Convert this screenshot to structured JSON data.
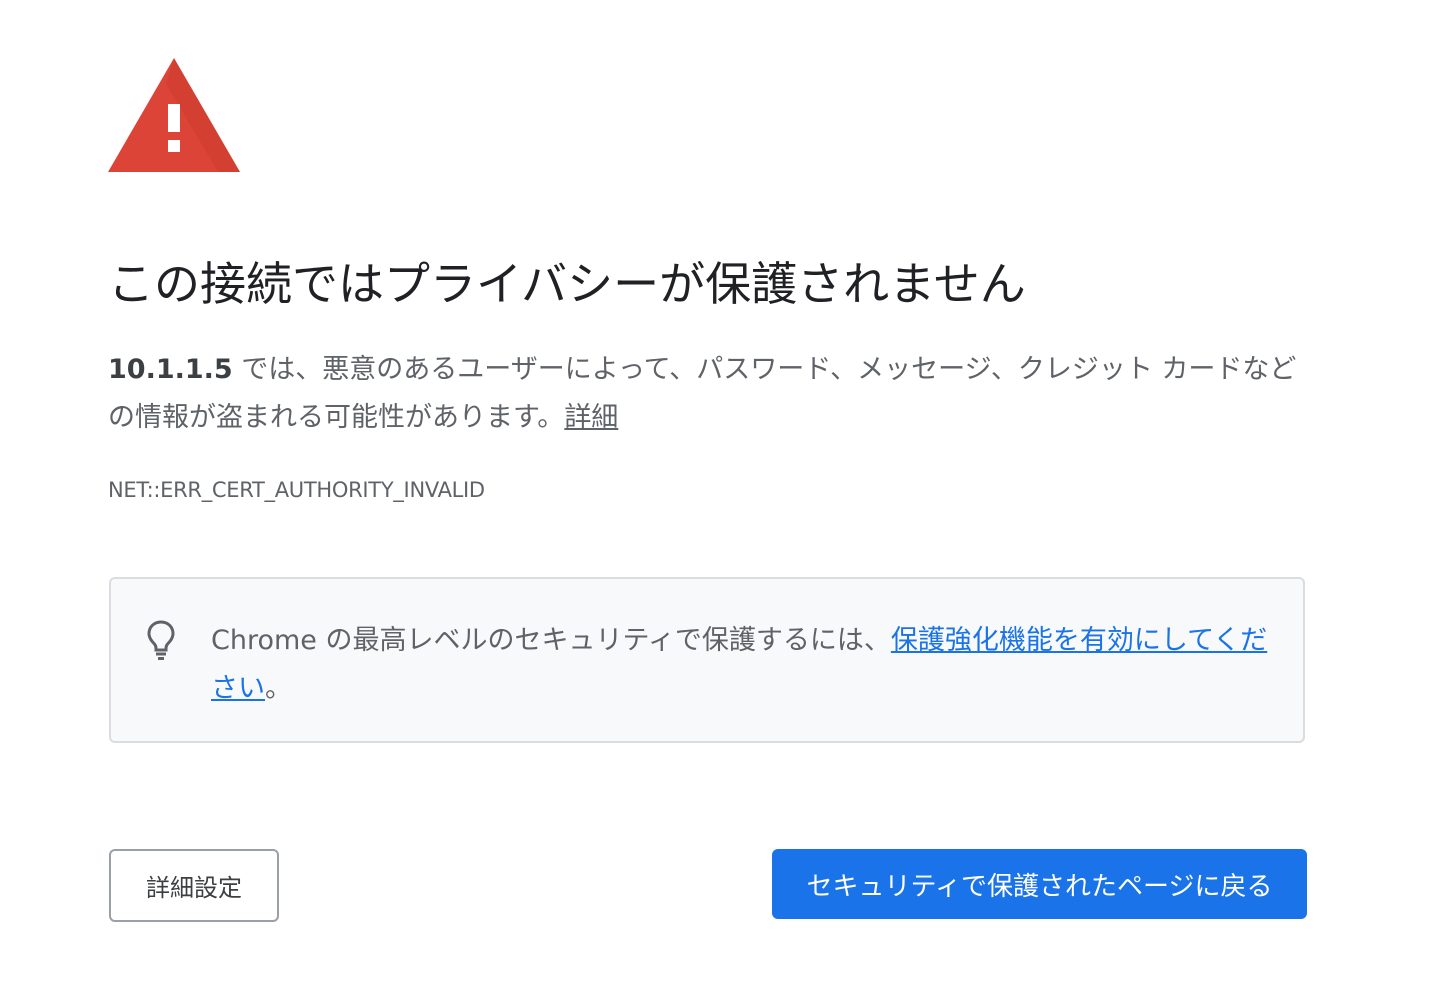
{
  "title": "この接続ではプライバシーが保護されません",
  "explanation": {
    "host": "10.1.1.5",
    "message": " では、悪意のあるユーザーによって、パスワード、メッセージ、クレジット カードなどの情報が盗まれる可能性があります。",
    "details_link": "詳細"
  },
  "error_code": "NET::ERR_CERT_AUTHORITY_INVALID",
  "enhanced_protection": {
    "text": "Chrome の最高レベルのセキュリティで保護するには、",
    "link": "保護強化機能を有効にしてください",
    "suffix": "。"
  },
  "buttons": {
    "advanced": "詳細設定",
    "back_to_safety": "セキュリティで保護されたページに戻る"
  },
  "colors": {
    "warning_red": "#db4437",
    "link_blue": "#1a73e8",
    "primary_button": "#1a73e8"
  }
}
